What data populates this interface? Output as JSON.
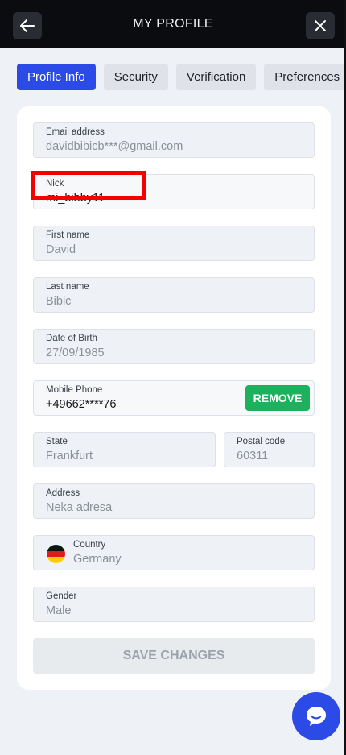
{
  "header": {
    "title": "MY PROFILE"
  },
  "tabs": [
    {
      "label": "Profile Info",
      "active": true
    },
    {
      "label": "Security",
      "active": false
    },
    {
      "label": "Verification",
      "active": false
    },
    {
      "label": "Preferences",
      "active": false
    }
  ],
  "form": {
    "email": {
      "label": "Email address",
      "value": "davidbibicb***@gmail.com"
    },
    "nick": {
      "label": "Nick",
      "value": "mi_bibby11"
    },
    "first_name": {
      "label": "First name",
      "value": "David"
    },
    "last_name": {
      "label": "Last name",
      "value": "Bibic"
    },
    "dob": {
      "label": "Date of Birth",
      "value": "27/09/1985"
    },
    "phone": {
      "label": "Mobile Phone",
      "value": "+49662****76",
      "remove_label": "REMOVE"
    },
    "state": {
      "label": "State",
      "value": "Frankfurt"
    },
    "postal": {
      "label": "Postal code",
      "value": "60311"
    },
    "address": {
      "label": "Address",
      "value": "Neka adresa"
    },
    "country": {
      "label": "Country",
      "value": "Germany"
    },
    "gender": {
      "label": "Gender",
      "value": "Male"
    },
    "save_label": "SAVE CHANGES"
  },
  "colors": {
    "accent": "#2b4ae6",
    "remove": "#1db15d",
    "highlight": "#f30000",
    "header_bg": "#0b0c0f"
  },
  "icons": {
    "back": "arrow-left-icon",
    "close": "close-icon",
    "flag": "germany-flag-icon",
    "chat": "chat-bubble-icon"
  }
}
